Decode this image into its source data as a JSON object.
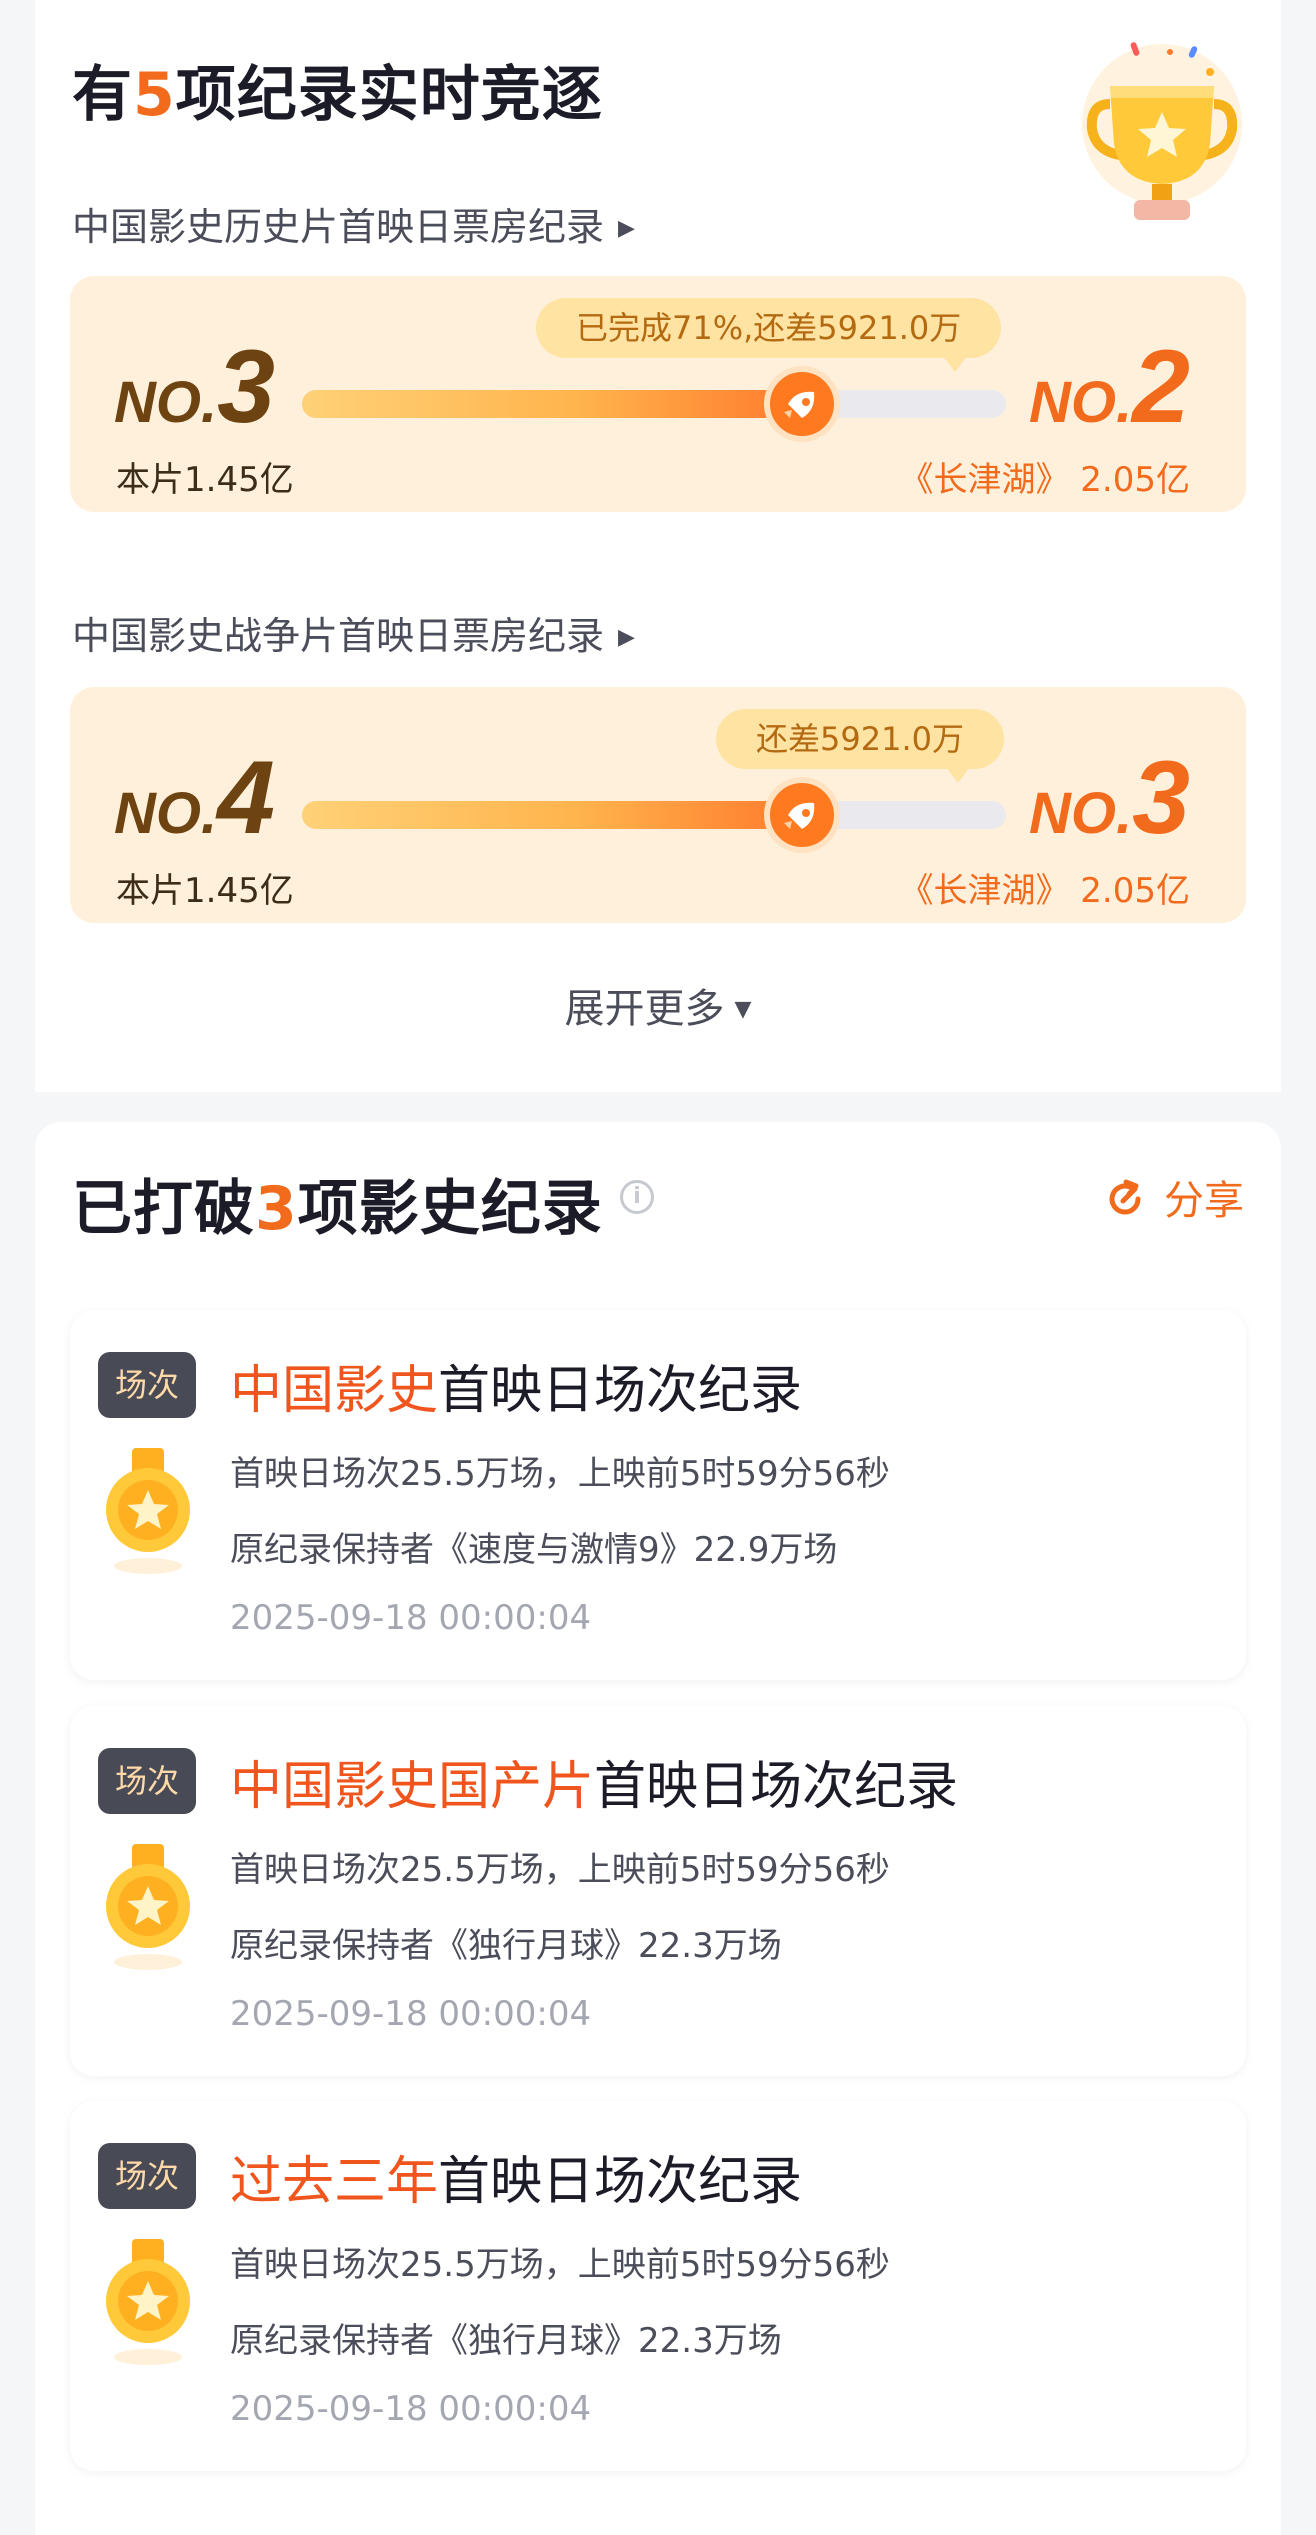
{
  "live": {
    "title_pre": "有",
    "title_count": "5",
    "title_post": "项纪录实时竞逐",
    "records": [
      {
        "title": "中国影史历史片首映日票房纪录",
        "bubble": "已完成71%,还差5921.0万",
        "progress": 0.71,
        "left_rank": "3",
        "left_label": "本片1.45亿",
        "right_rank": "2",
        "right_label": "《长津湖》 2.05亿"
      },
      {
        "title": "中国影史战争片首映日票房纪录",
        "bubble": "还差5921.0万",
        "progress": 0.71,
        "left_rank": "4",
        "left_label": "本片1.45亿",
        "right_rank": "3",
        "right_label": "《长津湖》 2.05亿"
      }
    ],
    "rank_prefix": "NO.",
    "expand_label": "展开更多"
  },
  "broken": {
    "title_pre": "已打破",
    "title_count": "3",
    "title_post": "项影史纪录",
    "info_glyph": "i",
    "share_label": "分享",
    "items": [
      {
        "tag": "场次",
        "title_highlight": "中国影史",
        "title_rest": "首映日场次纪录",
        "line1": "首映日场次25.5万场，上映前5时59分56秒",
        "line2": "原纪录保持者《速度与激情9》22.9万场",
        "time": "2025-09-18 00:00:04"
      },
      {
        "tag": "场次",
        "title_highlight": "中国影史国产片",
        "title_rest": "首映日场次纪录",
        "line1": "首映日场次25.5万场，上映前5时59分56秒",
        "line2": "原纪录保持者《独行月球》22.3万场",
        "time": "2025-09-18 00:00:04"
      },
      {
        "tag": "场次",
        "title_highlight": "过去三年",
        "title_rest": "首映日场次纪录",
        "line1": "首映日场次25.5万场，上映前5时59分56秒",
        "line2": "原纪录保持者《独行月球》22.3万场",
        "time": "2025-09-18 00:00:04"
      }
    ]
  },
  "icons": {
    "trophy": "trophy-icon",
    "rocket": "rocket-icon",
    "medal": "medal-icon",
    "share": "refresh-share-icon",
    "info": "info-icon",
    "caret": "triangle-right-icon",
    "expand_caret": "triangle-down-icon"
  },
  "colors": {
    "accent": "#f26b1d",
    "highlight": "#f0551e",
    "race_bg": "#fff0db",
    "bubble_bg": "#ffe3a3",
    "rank_left": "#6e4312",
    "tag_bg": "#484a55",
    "tag_text": "#ffd9a8"
  }
}
